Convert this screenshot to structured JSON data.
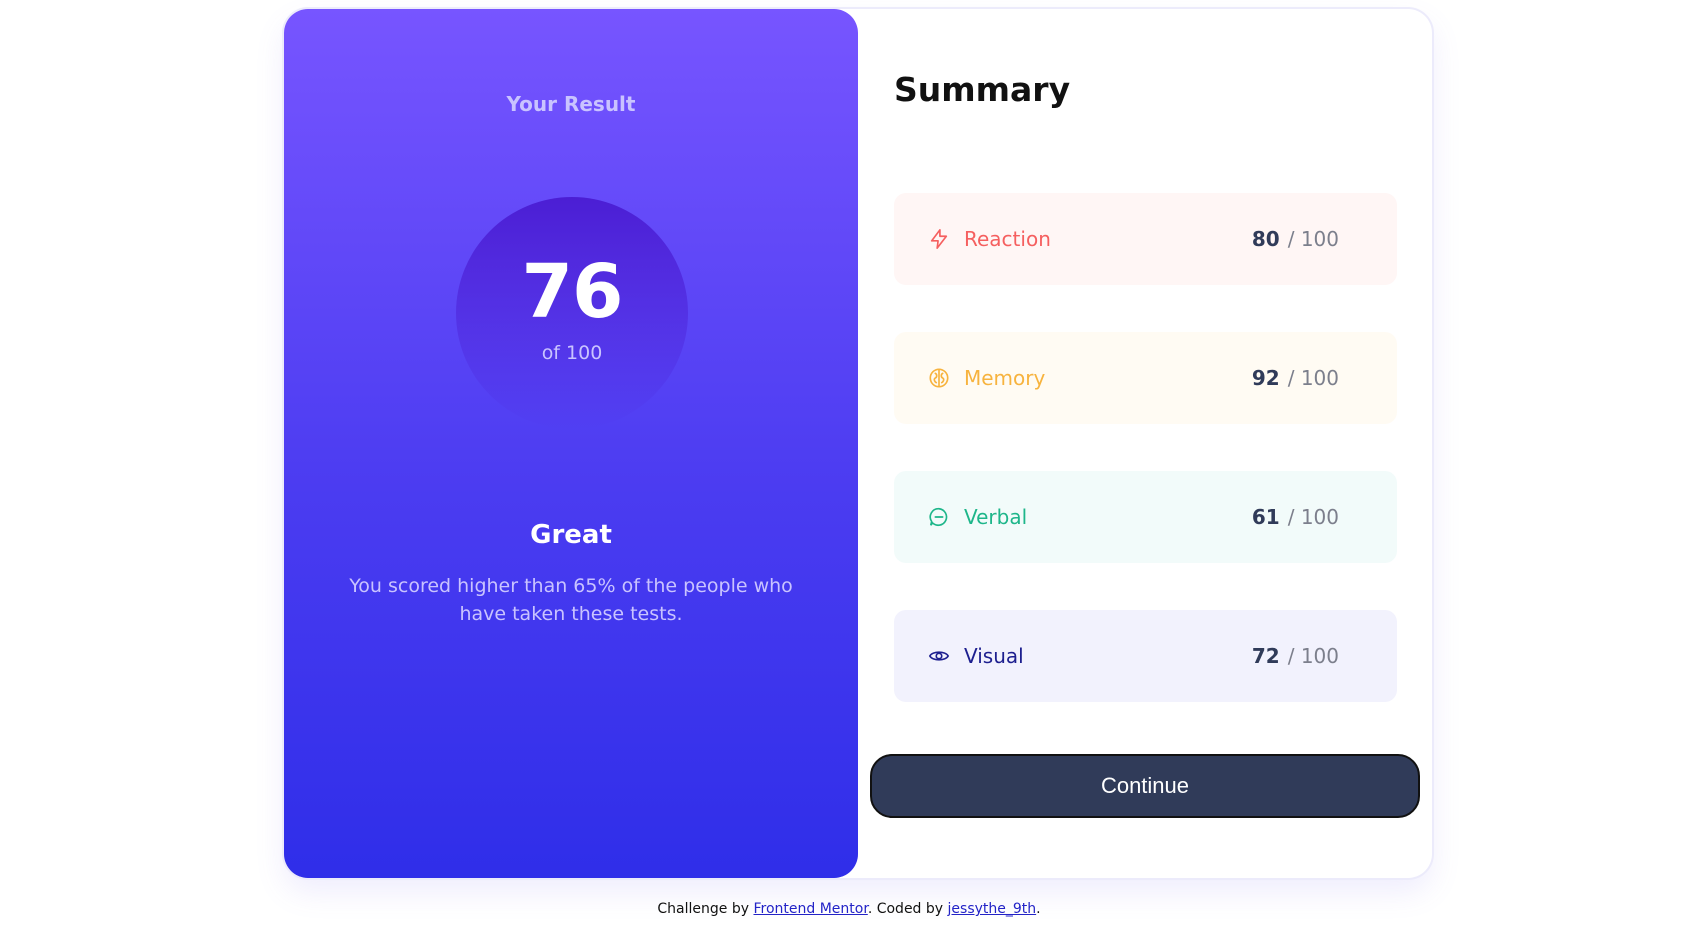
{
  "result": {
    "title": "Your Result",
    "score": "76",
    "score_of": "of 100",
    "rating": "Great",
    "description": "You scored higher than 65% of the people who have taken these tests."
  },
  "summary": {
    "title": "Summary",
    "items": [
      {
        "label": "Reaction",
        "score": "80",
        "max": "/ 100",
        "icon": "lightning-icon",
        "color": "#f55f5f",
        "bg": "#fff6f5"
      },
      {
        "label": "Memory",
        "score": "92",
        "max": "/ 100",
        "icon": "brain-icon",
        "color": "#f7b33e",
        "bg": "#fffbf3"
      },
      {
        "label": "Verbal",
        "score": "61",
        "max": "/ 100",
        "icon": "chat-bubble-icon",
        "color": "#1eb68a",
        "bg": "#f2fbfa"
      },
      {
        "label": "Visual",
        "score": "72",
        "max": "/ 100",
        "icon": "eye-icon",
        "color": "#1d1f8f",
        "bg": "#f2f2fd"
      }
    ]
  },
  "continue_label": "Continue",
  "footer": {
    "prefix": "Challenge by ",
    "link1": "Frontend Mentor",
    "middle": ". Coded by ",
    "link2": "jessythe_9th",
    "suffix": "."
  },
  "colors": {
    "gradient_top": "#7755ff",
    "gradient_bottom": "#2f2ee9",
    "button": "#303b59"
  }
}
